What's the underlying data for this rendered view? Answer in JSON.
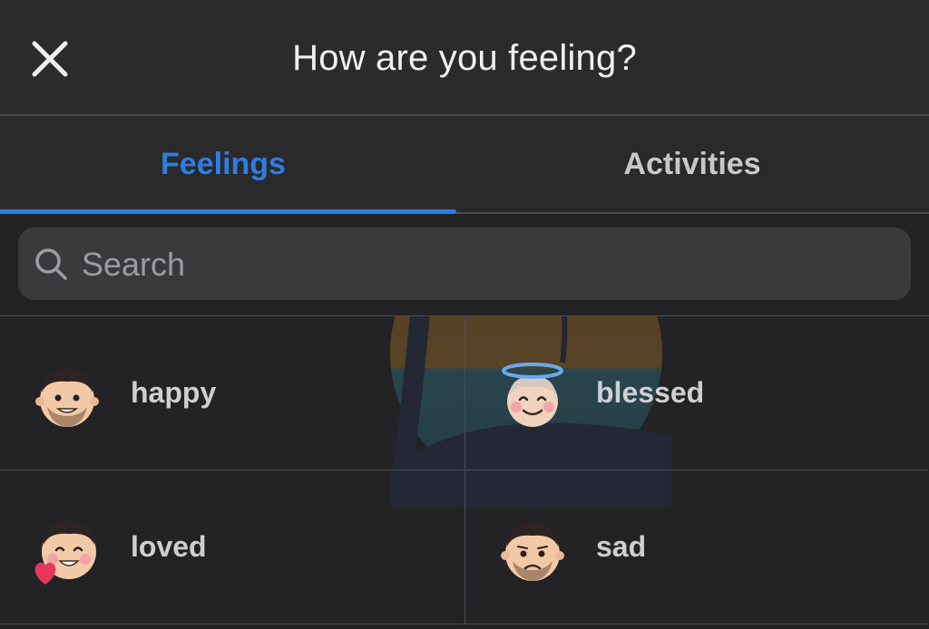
{
  "header": {
    "title": "How are you feeling?",
    "close_icon": "close-icon"
  },
  "tabs": [
    {
      "label": "Feelings",
      "active": true
    },
    {
      "label": "Activities",
      "active": false
    }
  ],
  "search": {
    "placeholder": "Search",
    "icon": "search-icon"
  },
  "feelings": [
    {
      "label": "happy",
      "icon": "happy-face-icon"
    },
    {
      "label": "blessed",
      "icon": "halo-face-icon"
    },
    {
      "label": "loved",
      "icon": "heart-face-icon"
    },
    {
      "label": "sad",
      "icon": "sad-face-icon"
    }
  ],
  "colors": {
    "accent": "#2f7de1",
    "background": "#232325",
    "header": "#2b2b2d",
    "search_field": "#3a3a3c"
  }
}
